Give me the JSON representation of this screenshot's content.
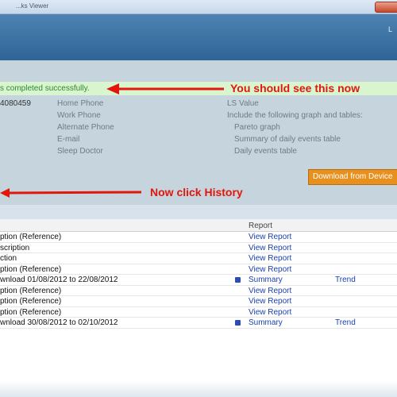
{
  "window": {
    "title": "...ks Viewer"
  },
  "header": {
    "edge_text": "L"
  },
  "status": {
    "message": "s completed successfully."
  },
  "annotations": {
    "see_this": "You should see this now",
    "click_history": "Now click History"
  },
  "patient": {
    "phone_number": "4080459",
    "fields": [
      "Home Phone",
      "Work Phone",
      "Alternate Phone",
      "E-mail",
      "Sleep Doctor"
    ]
  },
  "report_options": {
    "ls_value": "LS Value",
    "include_label": "Include the following graph and tables:",
    "items": [
      "Pareto graph",
      "Summary of daily events table",
      "Daily events table"
    ]
  },
  "download_button": {
    "label": "Download from Device"
  },
  "history": {
    "report_header": "Report",
    "rows": [
      {
        "desc": "ption (Reference)",
        "link": "View Report",
        "trend": ""
      },
      {
        "desc": "scription",
        "link": "View Report",
        "trend": ""
      },
      {
        "desc": "ction",
        "link": "View Report",
        "trend": ""
      },
      {
        "desc": "ption (Reference)",
        "link": "View Report",
        "trend": ""
      },
      {
        "desc": "wnload 01/08/2012 to 22/08/2012",
        "link": "Summary",
        "trend": "Trend"
      },
      {
        "desc": "ption (Reference)",
        "link": "View Report",
        "trend": ""
      },
      {
        "desc": "ption (Reference)",
        "link": "View Report",
        "trend": ""
      },
      {
        "desc": "ption (Reference)",
        "link": "View Report",
        "trend": ""
      },
      {
        "desc": "wnload 30/08/2012 to 02/10/2012",
        "link": "Summary",
        "trend": "Trend"
      }
    ]
  },
  "colors": {
    "accent_red": "#e2170c",
    "link_blue": "#1a3fb0",
    "success_green": "#2e8a2e",
    "button_orange": "#e8901e"
  }
}
